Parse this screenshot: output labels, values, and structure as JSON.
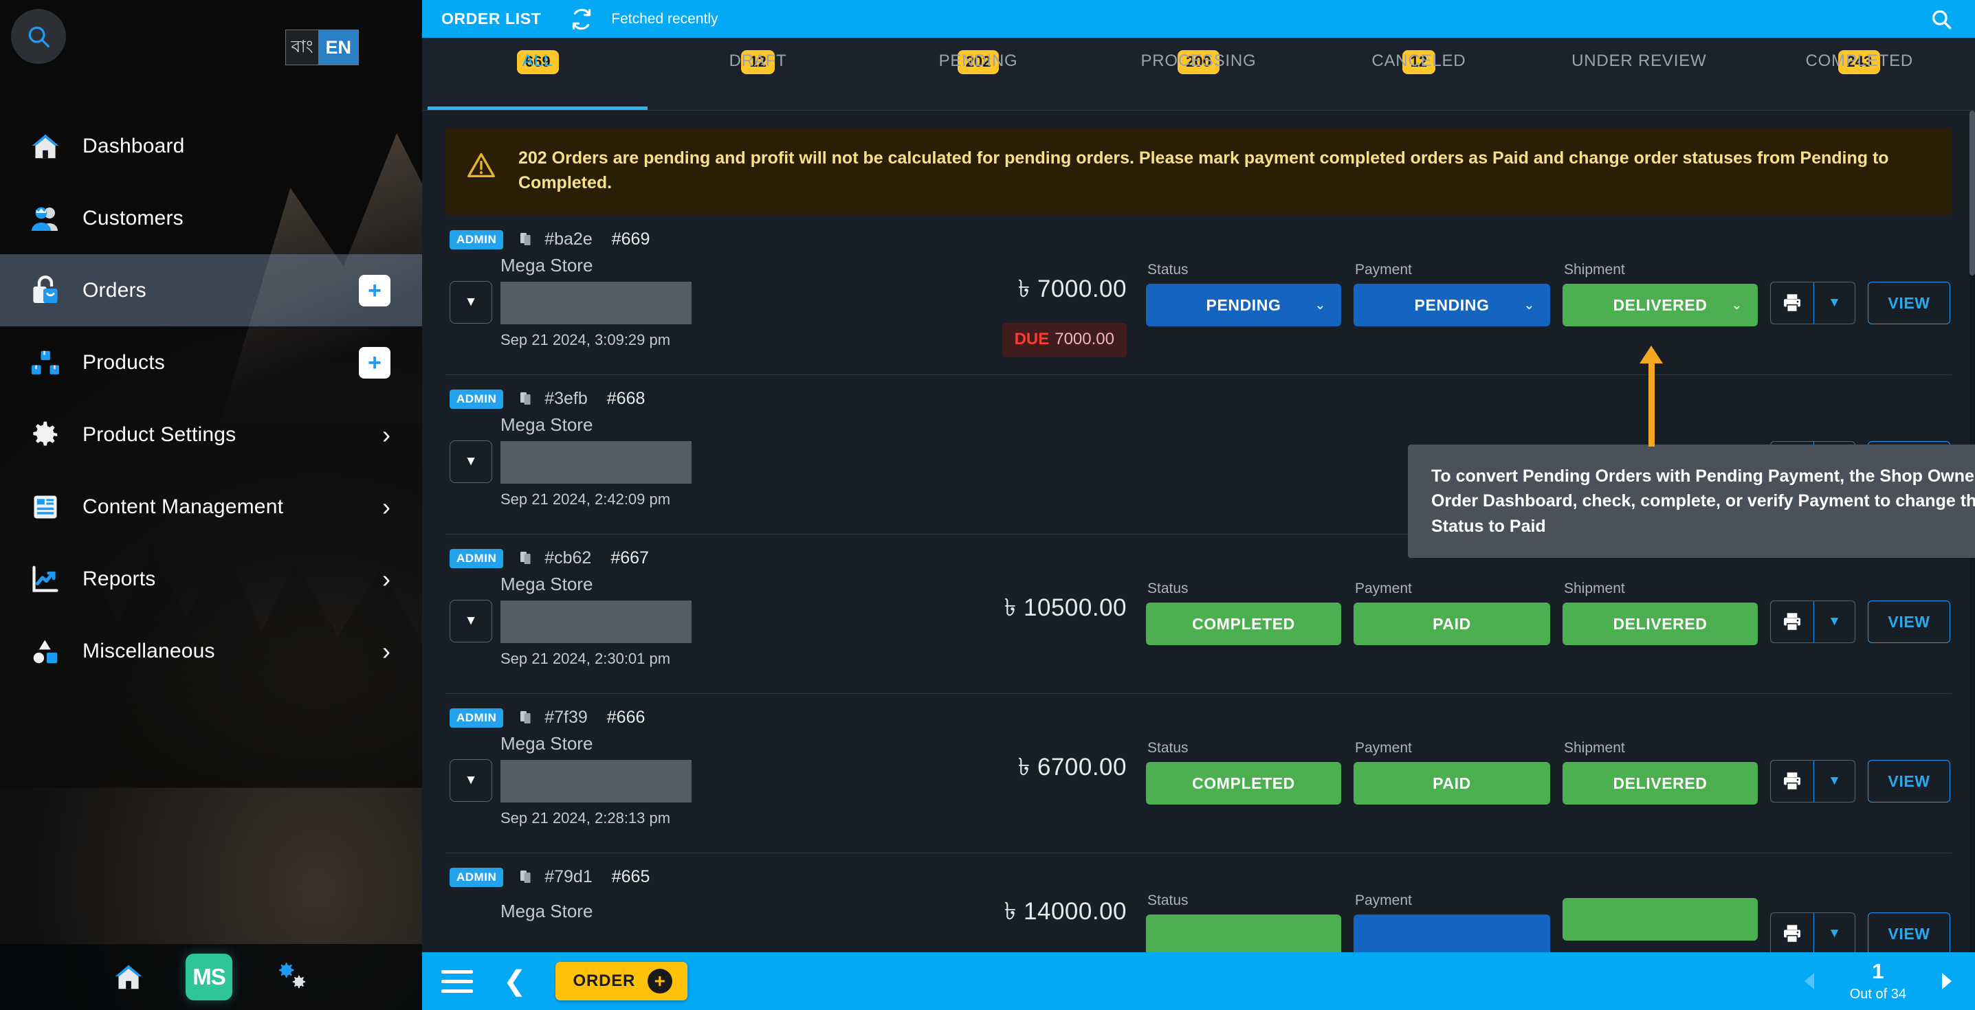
{
  "sidebar": {
    "search_icon": "search-icon",
    "language": {
      "bn_label": "বাং",
      "en_label": "EN"
    },
    "items": [
      {
        "label": "Dashboard",
        "icon": "home-icon",
        "action": "none"
      },
      {
        "label": "Customers",
        "icon": "customers-icon",
        "action": "none"
      },
      {
        "label": "Orders",
        "icon": "orders-bag-icon",
        "action": "plus",
        "active": true
      },
      {
        "label": "Products",
        "icon": "products-icon",
        "action": "plus"
      },
      {
        "label": "Product Settings",
        "icon": "gear-icon",
        "action": "chevron"
      },
      {
        "label": "Content Management",
        "icon": "content-icon",
        "action": "chevron"
      },
      {
        "label": "Reports",
        "icon": "chart-line-icon",
        "action": "chevron"
      },
      {
        "label": "Miscellaneous",
        "icon": "shapes-icon",
        "action": "chevron"
      }
    ],
    "bottom": {
      "home_icon": "home-icon",
      "logo_text": "MS",
      "settings_icon": "gears-icon"
    }
  },
  "header": {
    "title": "ORDER LIST",
    "refresh_icon": "refresh-icon",
    "fetched_text": "Fetched recently",
    "search_icon": "search-icon"
  },
  "tabs": [
    {
      "label": "ALL",
      "badge": "669",
      "active": true
    },
    {
      "label": "DRAFT",
      "badge": "12",
      "active": false
    },
    {
      "label": "PENDING",
      "badge": "202",
      "active": false
    },
    {
      "label": "PROCESSING",
      "badge": "200",
      "active": false
    },
    {
      "label": "CANCELED",
      "badge": "12",
      "active": false
    },
    {
      "label": "UNDER REVIEW",
      "badge": "",
      "active": false
    },
    {
      "label": "COMPLETED",
      "badge": "243",
      "active": false
    }
  ],
  "alert": {
    "icon": "warning-triangle-icon",
    "text": "202 Orders are pending and profit will not be calculated for pending orders. Please mark payment completed orders as Paid and change order statuses from Pending to Completed."
  },
  "labels": {
    "status": "Status",
    "payment": "Payment",
    "shipment": "Shipment",
    "view": "VIEW",
    "admin": "ADMIN",
    "expand_caret": "▼",
    "pill_caret": "⌄"
  },
  "callout": {
    "text": "To convert Pending Orders with Pending Payment, the Shop Owner has to go to Order Dashboard, check, complete, or verify Payment to change the Payment Status to Paid",
    "arrow_color": "#f5a623"
  },
  "orders": [
    {
      "badge": "ADMIN",
      "hash": "#ba2e",
      "number": "#669",
      "store": "Mega Store",
      "date": "Sep 21 2024, 3:09:29 pm",
      "amount": "৳ 7000.00",
      "due_label": "DUE",
      "due_amount": "7000.00",
      "status": {
        "text": "PENDING",
        "color": "blue",
        "caret": true
      },
      "payment": {
        "text": "PENDING",
        "color": "blue",
        "caret": true
      },
      "shipment": {
        "text": "DELIVERED",
        "color": "green",
        "caret": true
      }
    },
    {
      "badge": "ADMIN",
      "hash": "#3efb",
      "number": "#668",
      "store": "Mega Store",
      "date": "Sep 21 2024, 2:42:09 pm",
      "amount": "",
      "due_label": "",
      "due_amount": "",
      "status": null,
      "payment": null,
      "shipment": null
    },
    {
      "badge": "ADMIN",
      "hash": "#cb62",
      "number": "#667",
      "store": "Mega Store",
      "date": "Sep 21 2024, 2:30:01 pm",
      "amount": "৳ 10500.00",
      "due_label": "",
      "due_amount": "",
      "status": {
        "text": "COMPLETED",
        "color": "green",
        "caret": false
      },
      "payment": {
        "text": "PAID",
        "color": "green",
        "caret": false
      },
      "shipment": {
        "text": "DELIVERED",
        "color": "green",
        "caret": false
      }
    },
    {
      "badge": "ADMIN",
      "hash": "#7f39",
      "number": "#666",
      "store": "Mega Store",
      "date": "Sep 21 2024, 2:28:13 pm",
      "amount": "৳ 6700.00",
      "due_label": "",
      "due_amount": "",
      "status": {
        "text": "COMPLETED",
        "color": "green",
        "caret": false
      },
      "payment": {
        "text": "PAID",
        "color": "green",
        "caret": false
      },
      "shipment": {
        "text": "DELIVERED",
        "color": "green",
        "caret": false
      }
    },
    {
      "badge": "ADMIN",
      "hash": "#79d1",
      "number": "#665",
      "store": "Mega Store",
      "date": "",
      "amount": "৳ 14000.00",
      "due_label": "",
      "due_amount": "",
      "status": {
        "text": "",
        "color": "green",
        "caret": false
      },
      "payment": {
        "text": "",
        "color": "blue",
        "caret": false
      },
      "shipment": {
        "text": "",
        "color": "green",
        "caret": false
      }
    }
  ],
  "bottombar": {
    "menu_icon": "hamburger-icon",
    "back_icon": "chevron-left-icon",
    "order_button": "ORDER",
    "order_plus_icon": "plus-icon",
    "pager": {
      "prev_icon": "triangle-left-icon",
      "page": "1",
      "out_of": "Out of 34",
      "next_icon": "triangle-right-icon"
    }
  },
  "colors": {
    "accent_blue": "#03a9f4",
    "badge_yellow": "#ffc629",
    "status_blue": "#1565c0",
    "status_green": "#4caf50",
    "due_red": "#ff3b30",
    "alert_bg": "#2a1f06",
    "alert_text": "#f7e08a"
  }
}
